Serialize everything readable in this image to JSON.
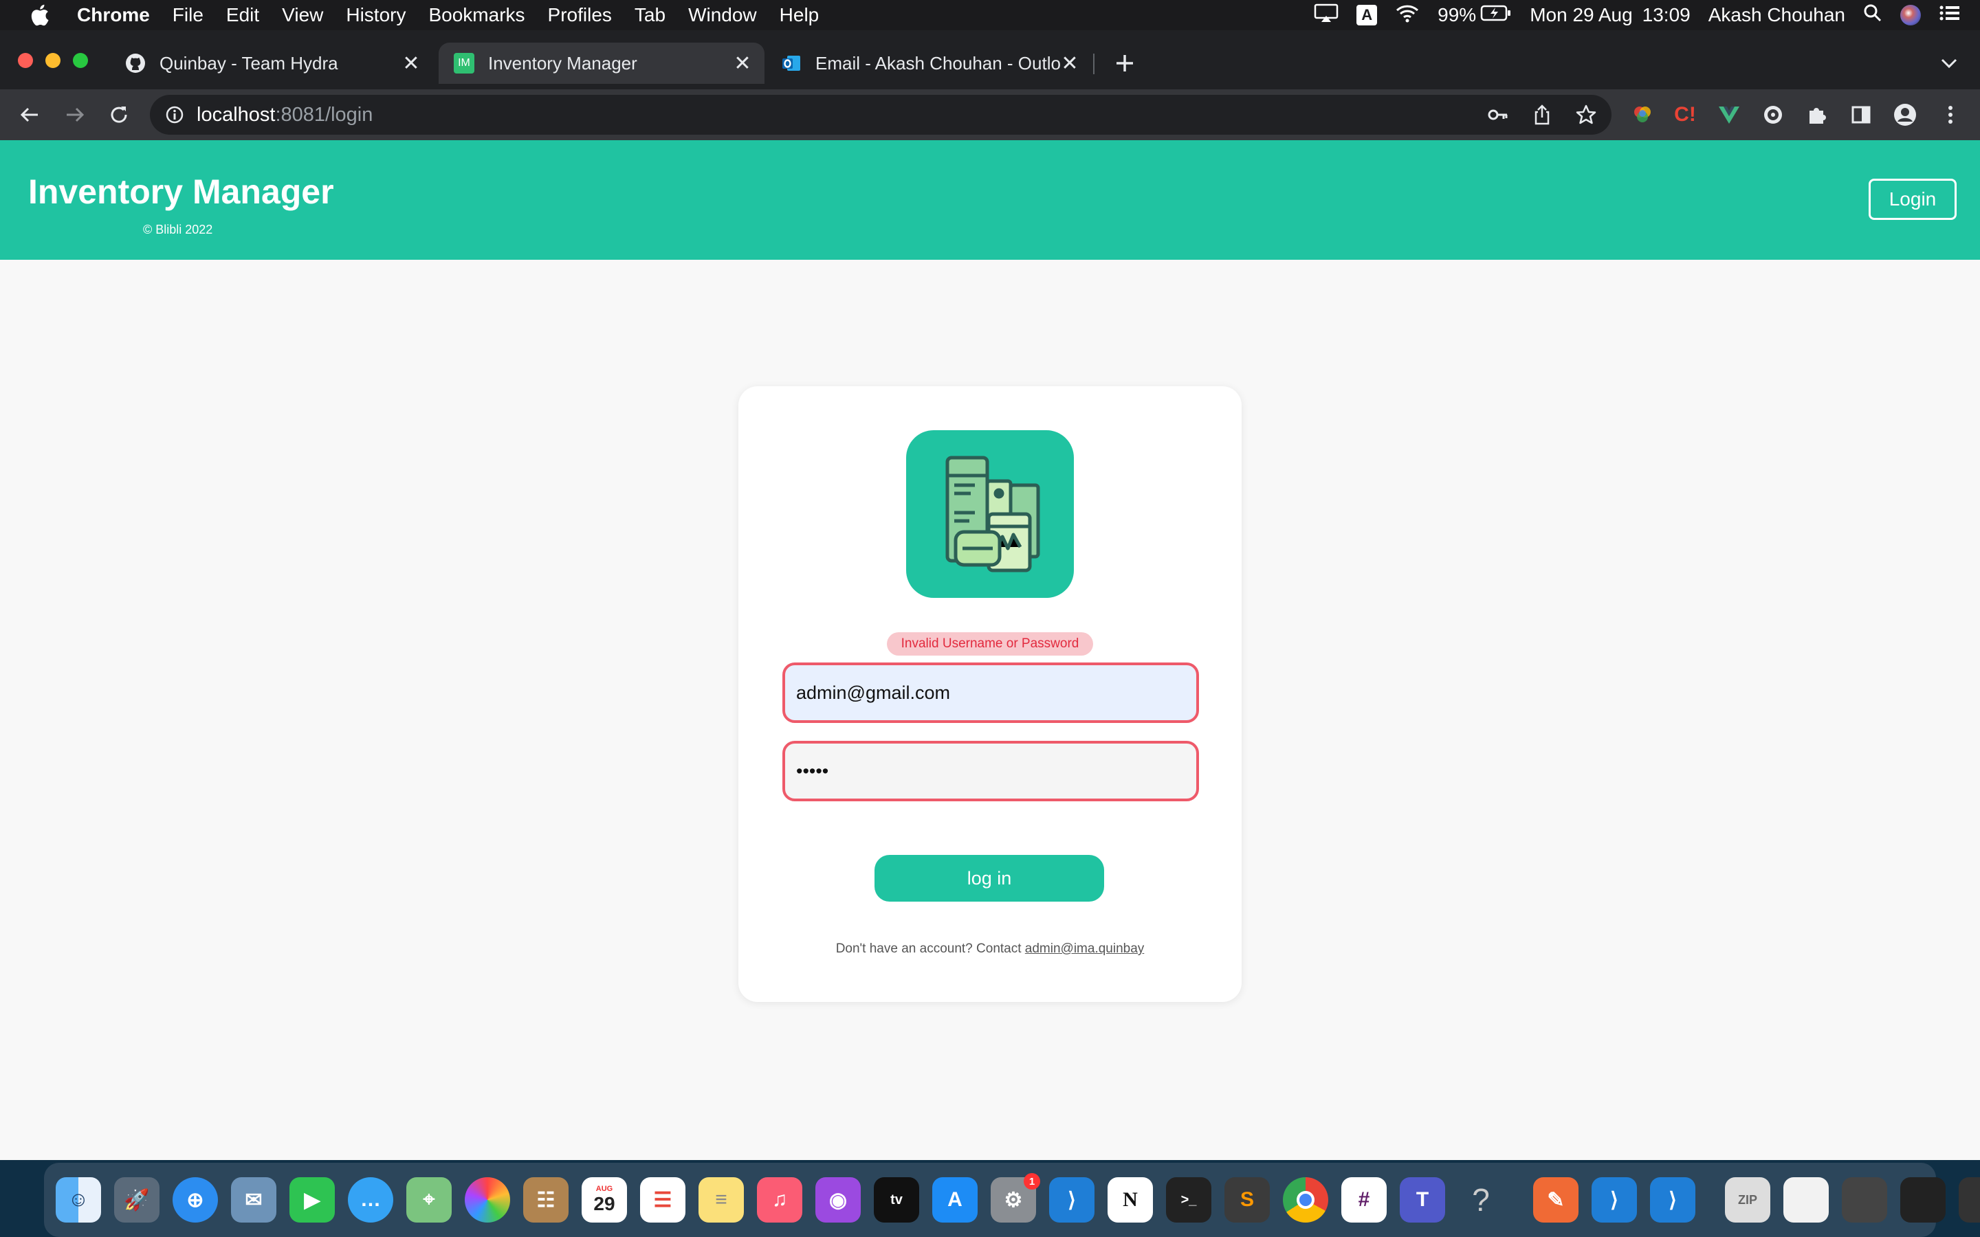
{
  "menubar": {
    "app_name": "Chrome",
    "items": [
      "File",
      "Edit",
      "View",
      "History",
      "Bookmarks",
      "Profiles",
      "Tab",
      "Window",
      "Help"
    ],
    "status": {
      "battery": "99%",
      "date": "Mon 29 Aug",
      "time": "13:09",
      "user": "Akash Chouhan",
      "input_indicator": "A"
    }
  },
  "tabs": [
    {
      "title": "Quinbay - Team Hydra",
      "icon": "github-icon"
    },
    {
      "title": "Inventory Manager",
      "icon": "IM",
      "active": true
    },
    {
      "title": "Email - Akash Chouhan - Outlo",
      "icon": "outlook-icon"
    }
  ],
  "address": {
    "host": "localhost",
    "path": ":8081/login"
  },
  "app": {
    "title": "Inventory Manager",
    "subtitle": "© Blibli 2022",
    "header_login_label": "Login"
  },
  "login_form": {
    "error_message": "Invalid Username or Password",
    "email_value": "admin@gmail.com",
    "password_value": "•••••",
    "submit_label": "log in",
    "footer_prefix": "Don't have an account? Contact ",
    "footer_link": "admin@ima.quinbay"
  },
  "dock": {
    "calendar_month": "AUG",
    "calendar_day": "29",
    "notification_badge": "1"
  },
  "colors": {
    "brand": "#20c3a1",
    "error": "#e22a3e",
    "error_bg": "#f8c7cc",
    "field_border": "#ee5a6a"
  }
}
